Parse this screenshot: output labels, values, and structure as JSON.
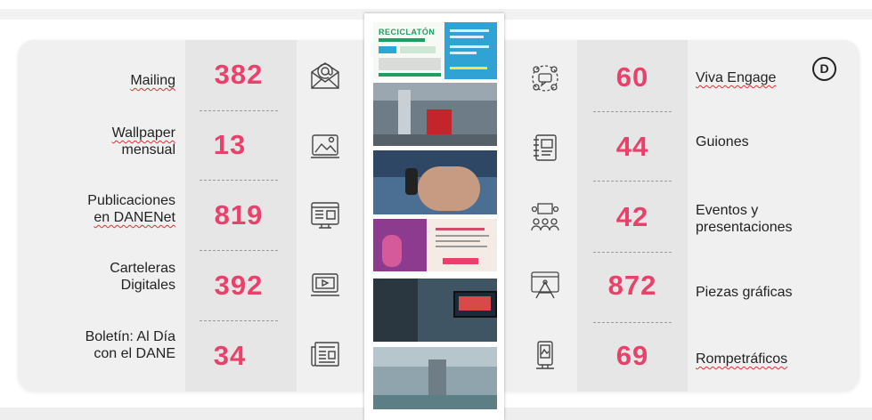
{
  "left_items": [
    {
      "label_lines": [
        "Mailing"
      ],
      "value": "382",
      "icon": "mail-icon"
    },
    {
      "label_lines": [
        "Wallpaper",
        "mensual"
      ],
      "value": "13",
      "icon": "wallpaper-image-icon"
    },
    {
      "label_lines": [
        "Publicaciones",
        "en DANENet"
      ],
      "value": "819",
      "icon": "web-publication-icon"
    },
    {
      "label_lines": [
        "Carteleras",
        "Digitales"
      ],
      "value": "392",
      "icon": "digital-screen-play-icon"
    },
    {
      "label_lines": [
        "Boletín: Al Día",
        "con el DANE"
      ],
      "value": "34",
      "icon": "newspaper-icon"
    }
  ],
  "right_items": [
    {
      "label_lines": [
        "Viva Engage"
      ],
      "value": "60",
      "icon": "community-chat-icon"
    },
    {
      "label_lines": [
        "Guiones"
      ],
      "value": "44",
      "icon": "script-notebook-icon"
    },
    {
      "label_lines": [
        "Eventos y",
        "presentaciones"
      ],
      "value": "42",
      "icon": "audience-presentation-icon"
    },
    {
      "label_lines": [
        "Piezas gráficas"
      ],
      "value": "872",
      "icon": "graphic-design-icon"
    },
    {
      "label_lines": [
        "Rompetráficos"
      ],
      "value": "69",
      "icon": "totem-stand-icon"
    }
  ],
  "logo_letter": "D",
  "photos": [
    {
      "kind": "flyer",
      "title": "RECICLATÓN",
      "icon": "reciclaton-flyer-image"
    },
    {
      "kind": "photo",
      "icon": "lobby-display-photo"
    },
    {
      "kind": "photo",
      "icon": "hand-remote-photo"
    },
    {
      "kind": "flyer",
      "icon": "purple-event-flyer-image"
    },
    {
      "kind": "photo",
      "icon": "tv-screen-photo"
    },
    {
      "kind": "photo",
      "icon": "hallway-totem-photo"
    }
  ],
  "colors": {
    "accent": "#e8416b",
    "card": "#f0f0f0",
    "numcol": "#e6e6e6"
  }
}
